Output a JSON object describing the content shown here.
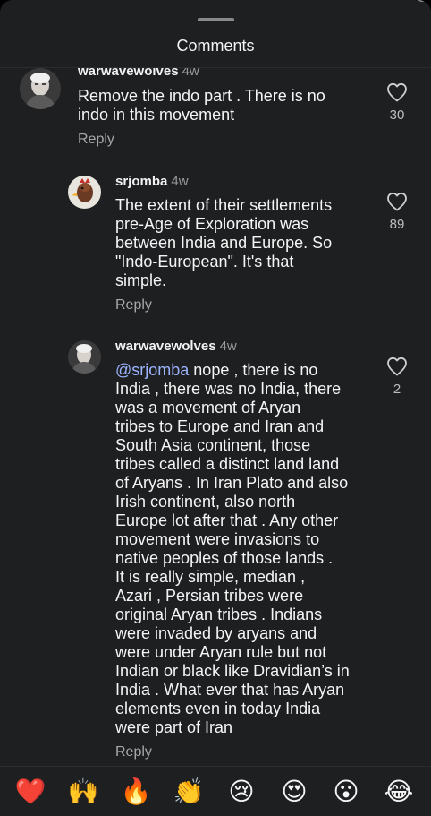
{
  "header": {
    "title": "Comments"
  },
  "comments": [
    {
      "username": "warwavewolves",
      "time": "4w",
      "lines": [
        "Remove the indo part . There is no",
        "indo in this movement"
      ],
      "reply_label": "Reply",
      "likes": "30"
    },
    {
      "username": "srjomba",
      "time": "4w",
      "lines": [
        "The extent of their settlements",
        "pre-Age of Exploration was",
        "between India and Europe. So",
        "\"Indo-European\". It's that",
        "simple."
      ],
      "reply_label": "Reply",
      "likes": "89"
    },
    {
      "username": "warwavewolves",
      "time": "4w",
      "mention": "@srjomba",
      "first_line_rest": " nope , there is no",
      "lines": [
        "India , there was no India, there",
        "was a movement of Aryan",
        "tribes to Europe and Iran and",
        "South Asia continent, those",
        "tribes called a distinct land land",
        "of Aryans . In Iran Plato and also",
        "Irish continent, also north",
        "Europe lot after that . Any other",
        "movement were invasions to",
        "native peoples of those lands .",
        "It is really simple, median ,",
        "Azari , Persian tribes were",
        "original Aryan tribes . Indians",
        "were invaded by aryans and",
        "were under Aryan rule but not",
        "Indian or black like Dravidian’s in",
        "India . What ever that has Aryan",
        "elements even in today India",
        "were part of Iran"
      ],
      "reply_label": "Reply",
      "likes": "2"
    }
  ],
  "emoji_bar": {
    "items": [
      {
        "emoji": "❤️",
        "name": "red-heart"
      },
      {
        "emoji": "🙌",
        "name": "raising-hands"
      },
      {
        "emoji": "🔥",
        "name": "fire"
      },
      {
        "emoji": "👏",
        "name": "clapping-hands"
      },
      {
        "emoji": "😢",
        "name": "crying-face"
      },
      {
        "emoji": "😍",
        "name": "heart-eyes"
      },
      {
        "emoji": "😮",
        "name": "surprised-face"
      },
      {
        "emoji": "😂",
        "name": "tears-of-joy"
      }
    ]
  },
  "colors": {
    "background": "#1e1f21",
    "text": "#f5f5f5",
    "secondary_text": "#9a9a9a",
    "mention": "#9bb4ff",
    "heart_red": "#ff2d55"
  }
}
